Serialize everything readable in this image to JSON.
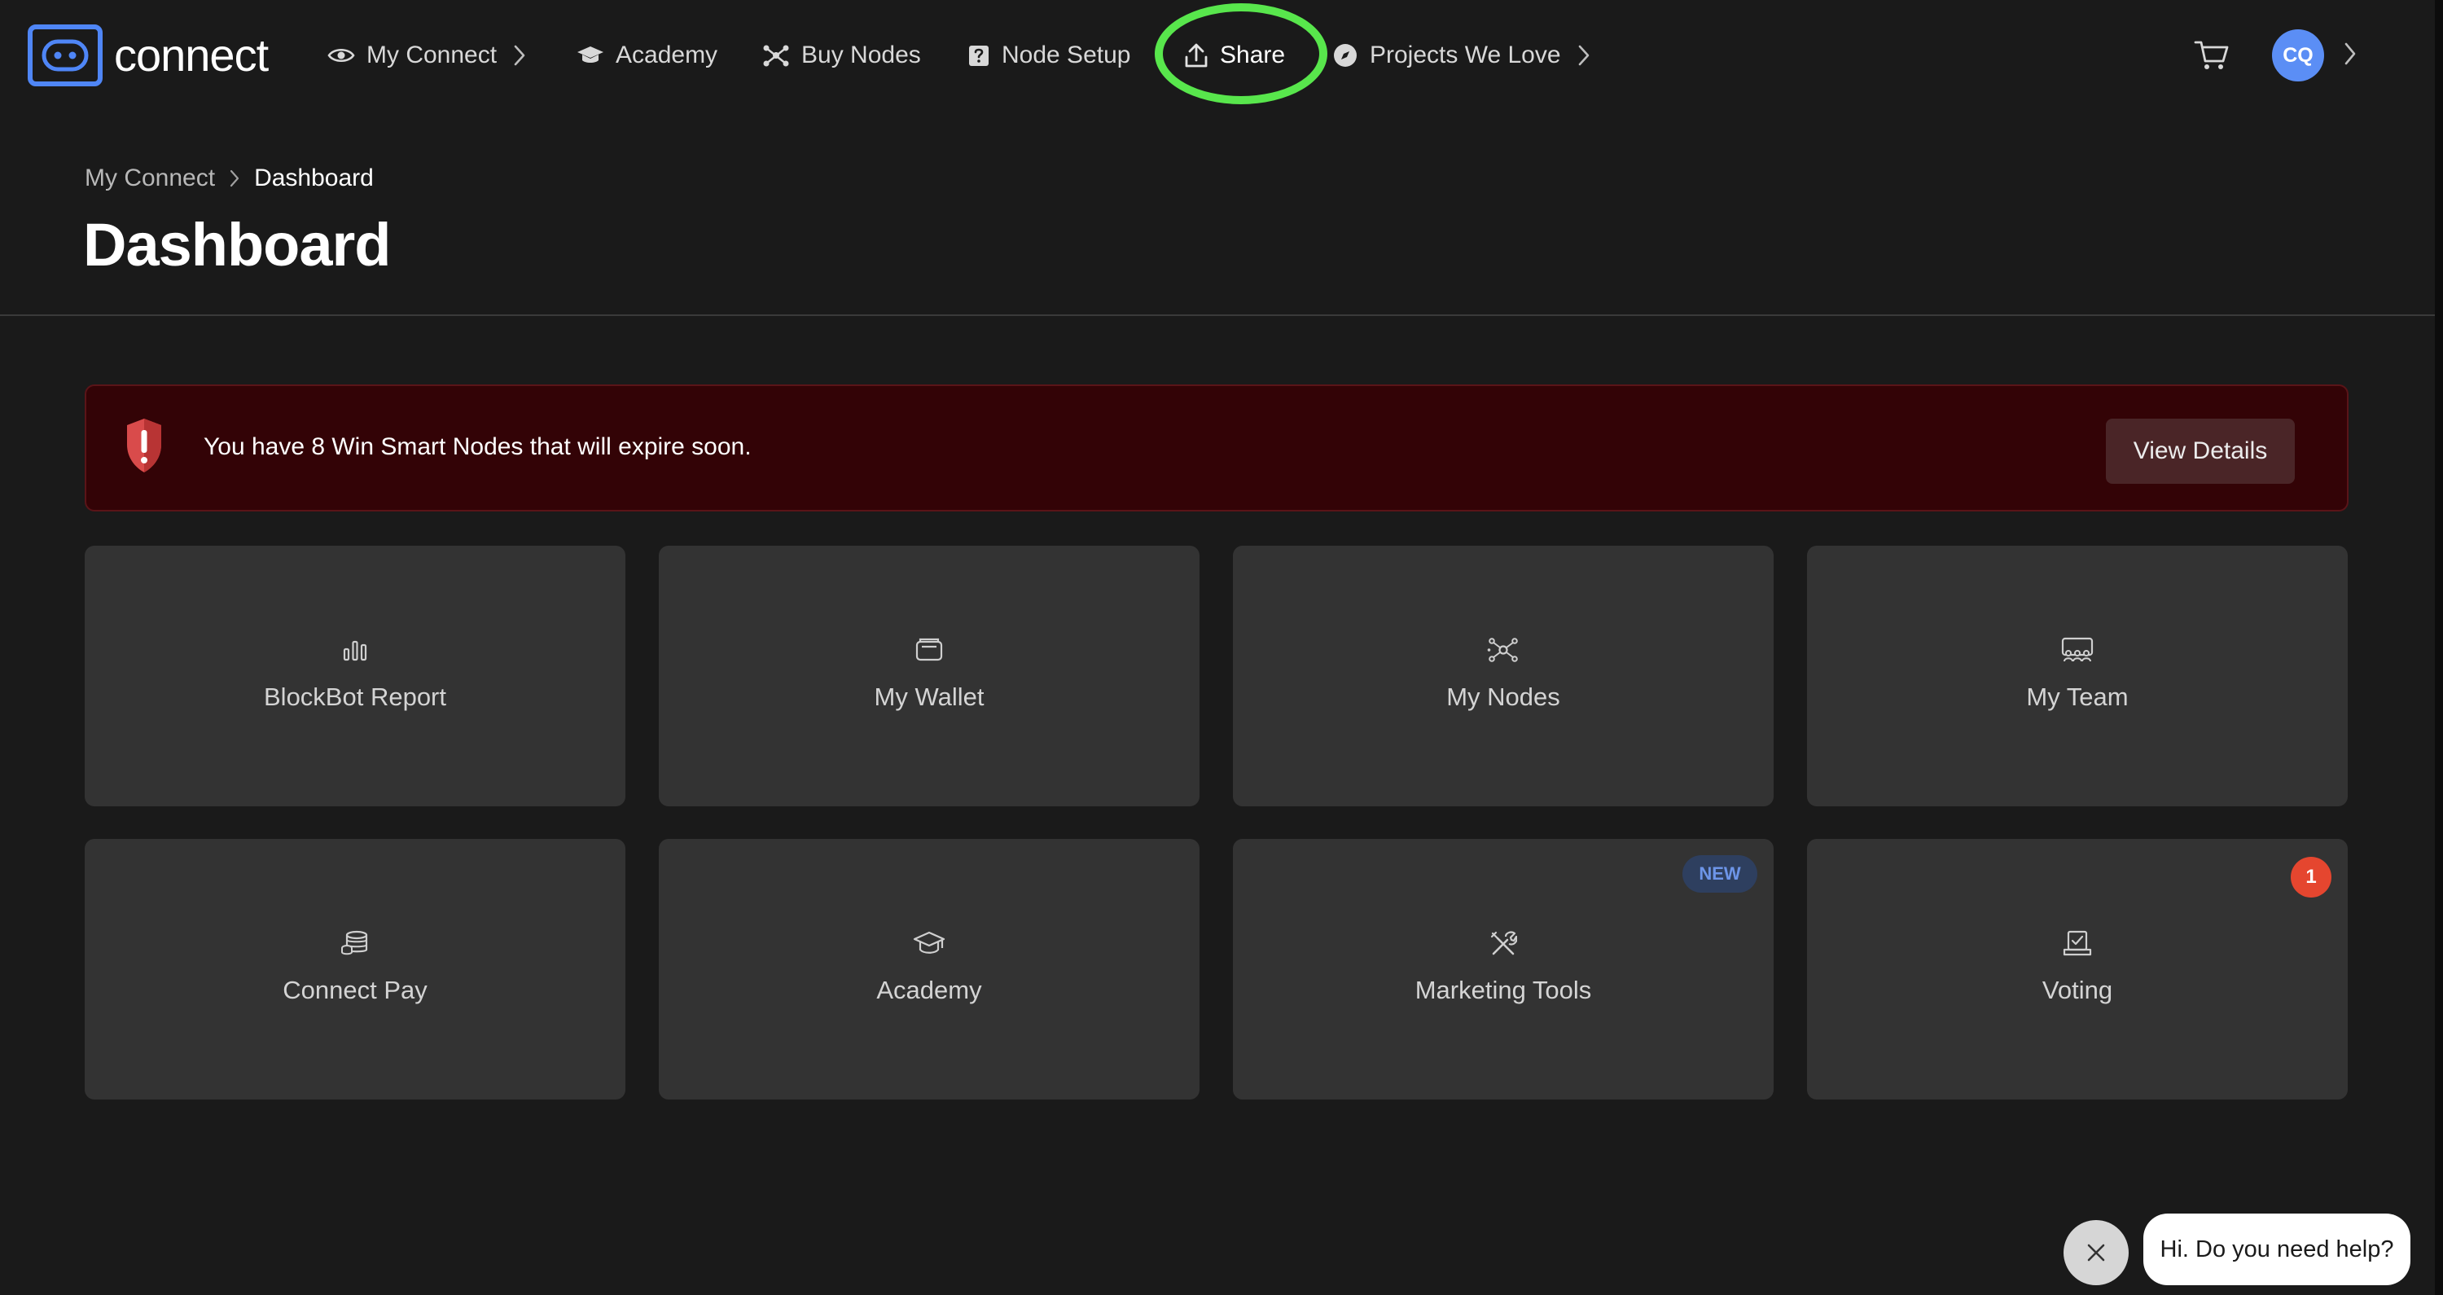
{
  "app": {
    "logo_text": "connect"
  },
  "nav": {
    "items": [
      {
        "label": "My Connect",
        "icon": "eye-icon",
        "has_chevron": true
      },
      {
        "label": "Academy",
        "icon": "graduation-cap-icon"
      },
      {
        "label": "Buy Nodes",
        "icon": "nodes-icon"
      },
      {
        "label": "Node Setup",
        "icon": "node-setup-icon"
      },
      {
        "label": "Share",
        "icon": "upload-icon",
        "highlighted": true
      },
      {
        "label": "Projects We Love",
        "icon": "compass-icon",
        "has_chevron": true
      }
    ],
    "cart_icon": "cart-icon",
    "avatar_initials": "CQ",
    "highlight_color": "#58e64c"
  },
  "breadcrumb": {
    "items": [
      "My Connect",
      "Dashboard"
    ]
  },
  "page_title": "Dashboard",
  "alert": {
    "message": "You have 8 Win Smart Nodes that will expire soon.",
    "button_label": "View Details",
    "icon": "shield-alert-icon"
  },
  "tiles": [
    {
      "label": "BlockBot Report",
      "icon": "bar-chart-icon"
    },
    {
      "label": "My Wallet",
      "icon": "wallet-icon"
    },
    {
      "label": "My Nodes",
      "icon": "network-icon"
    },
    {
      "label": "My Team",
      "icon": "team-icon"
    },
    {
      "label": "Connect Pay",
      "icon": "coins-icon"
    },
    {
      "label": "Academy",
      "icon": "graduation-cap-icon"
    },
    {
      "label": "Marketing Tools",
      "icon": "tools-icon",
      "badge": "NEW"
    },
    {
      "label": "Voting",
      "icon": "ballot-icon",
      "badge_count": "1"
    }
  ],
  "chat": {
    "message": "Hi. Do you need help?"
  },
  "colors": {
    "background": "#1a1a1a",
    "tile": "#333333",
    "alert_bg": "#330306",
    "accent_blue": "#4f86f7",
    "badge_red": "#e5462f"
  }
}
